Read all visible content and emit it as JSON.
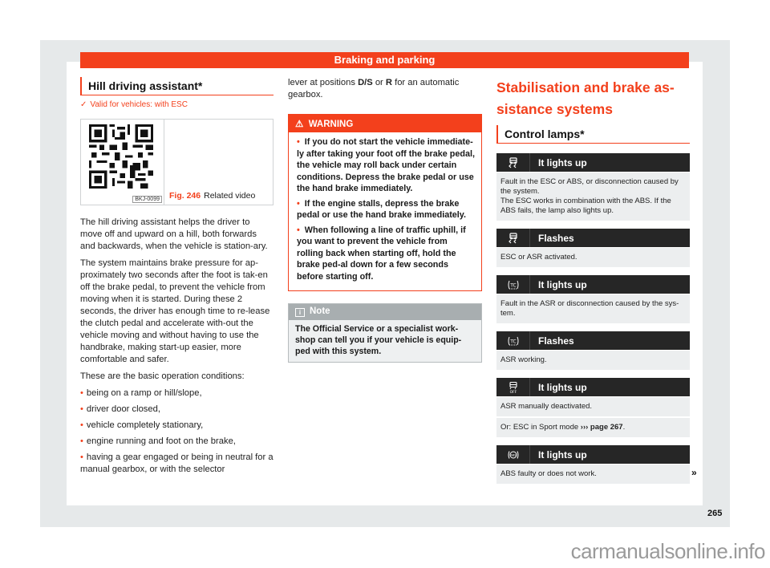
{
  "header": {
    "title": "Braking and parking"
  },
  "left": {
    "section_title": "Hill driving assistant*",
    "valid_icon": "check-icon",
    "valid_text": "Valid for vehicles: with ESC",
    "figure": {
      "code": "BKJ-0099",
      "number": "Fig. 246",
      "caption": "Related video"
    },
    "paragraphs": [
      "The hill driving assistant helps the driver to move off and upward on a hill, both forwards and backwards, when the vehicle is station-ary.",
      "The system maintains brake pressure for ap-proximately two seconds after the foot is tak-en off the brake pedal, to prevent the vehicle from moving when it is started. During these 2 seconds, the driver has enough time to re-lease the clutch pedal and accelerate with-out the vehicle moving and without having to use the handbrake, making start-up easier, more comfortable and safer.",
      "These are the basic operation conditions:"
    ],
    "bullets": [
      "being on a ramp or hill/slope,",
      "driver door closed,",
      "vehicle completely stationary,",
      "engine running and foot on the brake,",
      "having a gear engaged or being in neutral for a manual gearbox, or with the selector"
    ]
  },
  "middle": {
    "continuation": {
      "pre": "lever at positions ",
      "bold1": "D/S",
      "mid": " or ",
      "bold2": "R",
      "post": " for an automatic gearbox."
    },
    "warning": {
      "icon": "warning-triangle-icon",
      "title": "WARNING",
      "items": [
        "If you do not start the vehicle immediate-ly after taking your foot off the brake pedal, the vehicle may roll back under certain conditions. Depress the brake pedal or use the hand brake immediately.",
        "If the engine stalls, depress the brake pedal or use the hand brake immediately.",
        "When following a line of traffic uphill, if you want to prevent the vehicle from rolling back when starting off, hold the brake ped-al down for a few seconds before starting off."
      ]
    },
    "note": {
      "icon": "info-icon",
      "title": "Note",
      "text": "The Official Service or a specialist work-shop can tell you if your vehicle is equip-ped with this system."
    }
  },
  "right": {
    "chapter_title": "Stabilisation and brake as-sistance systems",
    "section_title": "Control lamps*",
    "lamps": [
      {
        "icon": "esc-lamp-icon",
        "label": "It lights up",
        "rows": [
          "Fault in the ESC or ABS, or disconnection caused by the system.\nThe ESC works in combination with the ABS. If the ABS fails, the lamp also lights up."
        ]
      },
      {
        "icon": "esc-lamp-icon",
        "label": "Flashes",
        "rows": [
          "ESC or ASR activated."
        ]
      },
      {
        "icon": "tc-lamp-icon",
        "label": "It lights up",
        "rows": [
          "Fault in the ASR or disconnection caused by the sys-tem."
        ]
      },
      {
        "icon": "tc-lamp-icon",
        "label": "Flashes",
        "rows": [
          "ASR working."
        ]
      },
      {
        "icon": "esc-off-lamp-icon",
        "label": "It lights up",
        "rows": [
          "ASR manually deactivated."
        ],
        "row2": {
          "pre": "Or: ESC in Sport mode ",
          "link": "››› page 267",
          "post": "."
        }
      },
      {
        "icon": "abs-lamp-icon",
        "label": "It lights up",
        "rows": [
          "ABS faulty or does not work."
        ]
      }
    ],
    "continue_mark": "»"
  },
  "footer": {
    "page_number": "265",
    "watermark": "carmanualsonline.info"
  },
  "colors": {
    "accent": "#f3401c",
    "lamp_header": "#262626",
    "lamp_row": "#eceeef",
    "note_header": "#a8aeb0",
    "frame": "#e6e9ea"
  }
}
